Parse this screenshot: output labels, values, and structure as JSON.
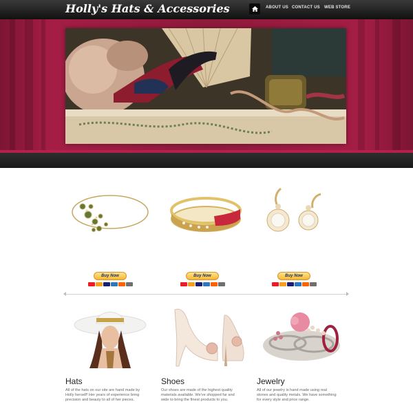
{
  "header": {
    "brand": "Holly's Hats & Accessories",
    "nav": [
      "ABOUT US",
      "CONTACT US",
      "WEB STORE"
    ]
  },
  "products": [
    {
      "name": "necklace",
      "buy_label": "Buy Now"
    },
    {
      "name": "bracelet",
      "buy_label": "Buy Now"
    },
    {
      "name": "pearl-earrings",
      "buy_label": "Buy Now"
    }
  ],
  "features": [
    {
      "title": "Hats",
      "text": "All of the hats on our site are hand made by Holly herself! Her years of experience bring precision and beauty to all of her pieces."
    },
    {
      "title": "Shoes",
      "text": "Our shoes are made of the highest quality materials available. We've shopped far and wide to bring the finest products to you."
    },
    {
      "title": "Jewelry",
      "text": "All of our jewelry is hand made using real stones and quality metals. We have something for every style and price range."
    }
  ],
  "icons": {
    "home": "home-icon"
  }
}
